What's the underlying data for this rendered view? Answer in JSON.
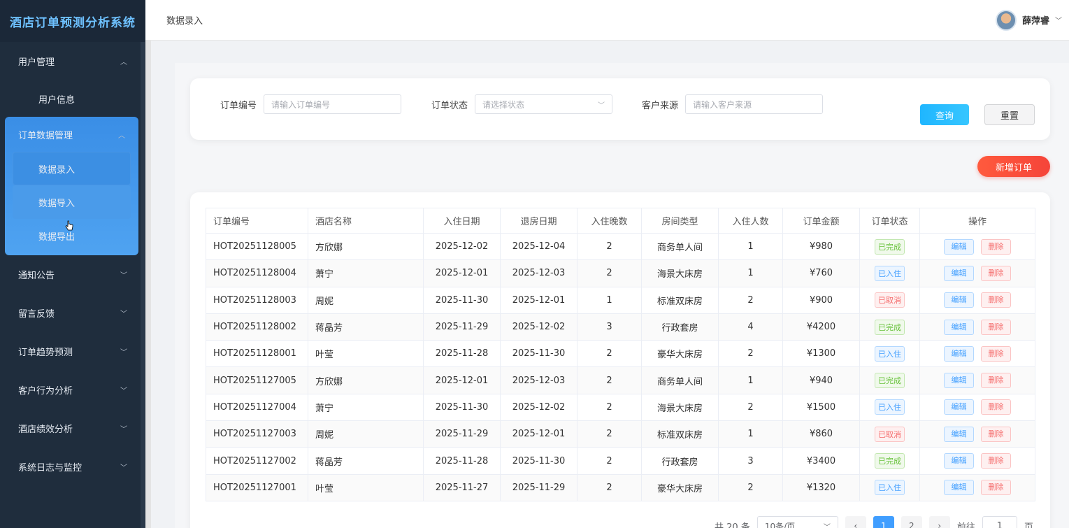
{
  "app_title": "酒店订单预测分析系统",
  "breadcrumb": "数据录入",
  "user": {
    "name": "薛萍睿"
  },
  "sidebar": {
    "user_mgmt": "用户管理",
    "user_info": "用户信息",
    "order_mgmt": "订单数据管理",
    "data_entry": "数据录入",
    "data_import": "数据导入",
    "data_export": "数据导出",
    "notice": "通知公告",
    "feedback": "留言反馈",
    "trend": "订单趋势预测",
    "behavior": "客户行为分析",
    "performance": "酒店绩效分析",
    "logs": "系统日志与监控"
  },
  "search": {
    "order_no_label": "订单编号",
    "order_no_placeholder": "请输入订单编号",
    "status_label": "订单状态",
    "status_placeholder": "请选择状态",
    "source_label": "客户来源",
    "source_placeholder": "请输入客户来源",
    "query": "查询",
    "reset": "重置"
  },
  "add_button": "新增订单",
  "table": {
    "headers": [
      "订单编号",
      "酒店名称",
      "入住日期",
      "退房日期",
      "入住晚数",
      "房间类型",
      "入住人数",
      "订单金额",
      "订单状态",
      "操作"
    ],
    "edit": "编辑",
    "delete": "删除",
    "rows": [
      {
        "no": "HOT20251128005",
        "hotel": "方欣娜",
        "in": "2025-12-02",
        "out": "2025-12-04",
        "nights": "2",
        "room": "商务单人间",
        "guests": "1",
        "amount": "¥980",
        "status": "已完成"
      },
      {
        "no": "HOT20251128004",
        "hotel": "萧宁",
        "in": "2025-12-01",
        "out": "2025-12-03",
        "nights": "2",
        "room": "海景大床房",
        "guests": "1",
        "amount": "¥760",
        "status": "已入住"
      },
      {
        "no": "HOT20251128003",
        "hotel": "周妮",
        "in": "2025-11-30",
        "out": "2025-12-01",
        "nights": "1",
        "room": "标准双床房",
        "guests": "2",
        "amount": "¥900",
        "status": "已取消"
      },
      {
        "no": "HOT20251128002",
        "hotel": "蒋晶芳",
        "in": "2025-11-29",
        "out": "2025-12-02",
        "nights": "3",
        "room": "行政套房",
        "guests": "4",
        "amount": "¥4200",
        "status": "已完成"
      },
      {
        "no": "HOT20251128001",
        "hotel": "叶莹",
        "in": "2025-11-28",
        "out": "2025-11-30",
        "nights": "2",
        "room": "豪华大床房",
        "guests": "2",
        "amount": "¥1300",
        "status": "已入住"
      },
      {
        "no": "HOT20251127005",
        "hotel": "方欣娜",
        "in": "2025-12-01",
        "out": "2025-12-03",
        "nights": "2",
        "room": "商务单人间",
        "guests": "1",
        "amount": "¥940",
        "status": "已完成"
      },
      {
        "no": "HOT20251127004",
        "hotel": "萧宁",
        "in": "2025-11-30",
        "out": "2025-12-02",
        "nights": "2",
        "room": "海景大床房",
        "guests": "2",
        "amount": "¥1500",
        "status": "已入住"
      },
      {
        "no": "HOT20251127003",
        "hotel": "周妮",
        "in": "2025-11-29",
        "out": "2025-12-01",
        "nights": "2",
        "room": "标准双床房",
        "guests": "1",
        "amount": "¥860",
        "status": "已取消"
      },
      {
        "no": "HOT20251127002",
        "hotel": "蒋晶芳",
        "in": "2025-11-28",
        "out": "2025-11-30",
        "nights": "2",
        "room": "行政套房",
        "guests": "3",
        "amount": "¥3400",
        "status": "已完成"
      },
      {
        "no": "HOT20251127001",
        "hotel": "叶莹",
        "in": "2025-11-27",
        "out": "2025-11-29",
        "nights": "2",
        "room": "豪华大床房",
        "guests": "2",
        "amount": "¥1320",
        "status": "已入住"
      }
    ]
  },
  "pager": {
    "total": "共 20 条",
    "size": "10条/页",
    "prev": "‹",
    "page1": "1",
    "page2": "2",
    "next": "›",
    "goto": "前往",
    "goto_value": "1",
    "page_unit": "页"
  },
  "colors": {
    "accent": "#409eff",
    "danger": "#f56c6c",
    "success": "#67c23a",
    "sidebar": "#1f2d3d"
  }
}
